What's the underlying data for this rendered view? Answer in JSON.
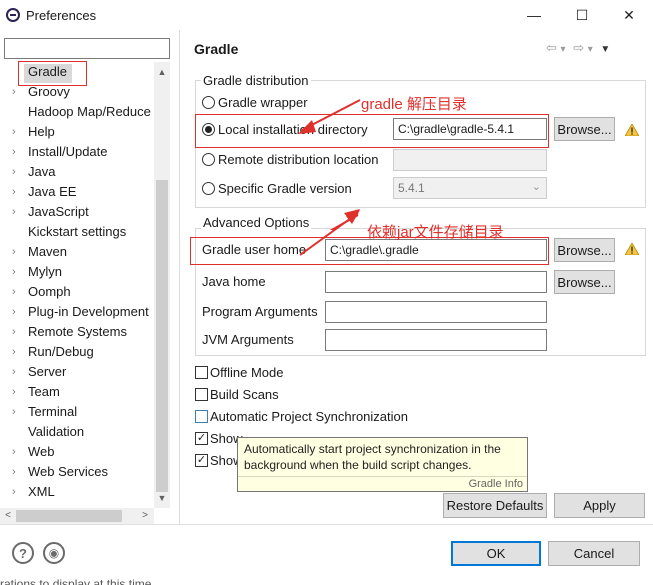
{
  "window": {
    "title": "Preferences",
    "minimize_glyph": "—",
    "maximize_glyph": "☐",
    "close_glyph": "✕"
  },
  "sidebar": {
    "filter_value": "",
    "items": [
      {
        "label": "Gradle",
        "expandable": false,
        "selected": true
      },
      {
        "label": "Groovy",
        "expandable": true
      },
      {
        "label": "Hadoop Map/Reduce",
        "expandable": false
      },
      {
        "label": "Help",
        "expandable": true
      },
      {
        "label": "Install/Update",
        "expandable": true
      },
      {
        "label": "Java",
        "expandable": true
      },
      {
        "label": "Java EE",
        "expandable": true
      },
      {
        "label": "JavaScript",
        "expandable": true
      },
      {
        "label": "Kickstart settings",
        "expandable": false
      },
      {
        "label": "Maven",
        "expandable": true
      },
      {
        "label": "Mylyn",
        "expandable": true
      },
      {
        "label": "Oomph",
        "expandable": true
      },
      {
        "label": "Plug-in Development",
        "expandable": true
      },
      {
        "label": "Remote Systems",
        "expandable": true
      },
      {
        "label": "Run/Debug",
        "expandable": true
      },
      {
        "label": "Server",
        "expandable": true
      },
      {
        "label": "Team",
        "expandable": true
      },
      {
        "label": "Terminal",
        "expandable": true
      },
      {
        "label": "Validation",
        "expandable": false
      },
      {
        "label": "Web",
        "expandable": true
      },
      {
        "label": "Web Services",
        "expandable": true
      },
      {
        "label": "XML",
        "expandable": true
      }
    ]
  },
  "page": {
    "title": "Gradle",
    "nav": {
      "back": "⇦",
      "back_menu": "▾",
      "forward": "⇨",
      "forward_menu": "▾",
      "menu": "▼"
    }
  },
  "distribution": {
    "group_title": "Gradle distribution",
    "wrapper_label": "Gradle wrapper",
    "local_label": "Local installation directory",
    "local_value": "C:\\gradle\\gradle-5.4.1",
    "remote_label": "Remote distribution location",
    "remote_value": "",
    "version_label": "Specific Gradle version",
    "version_value": "5.4.1",
    "browse_label": "Browse...",
    "selected": "local"
  },
  "advanced": {
    "group_title": "Advanced Options",
    "user_home_label": "Gradle user home",
    "user_home_value": "C:\\gradle\\.gradle",
    "java_home_label": "Java home",
    "java_home_value": "",
    "program_args_label": "Program Arguments",
    "program_args_value": "",
    "jvm_args_label": "JVM Arguments",
    "jvm_args_value": "",
    "browse_label": "Browse..."
  },
  "options": {
    "offline_mode": {
      "label": "Offline Mode",
      "checked": false
    },
    "build_scans": {
      "label": "Build Scans",
      "checked": false
    },
    "auto_sync": {
      "label": "Automatic Project Synchronization",
      "checked": false
    },
    "show_console": {
      "label": "Show",
      "checked": true
    },
    "show_executions": {
      "label": "Show",
      "checked": true
    },
    "check_glyph": "✓"
  },
  "tooltip": {
    "text": "Automatically start project synchronization in the background when the build script changes.",
    "footer": "Gradle Info"
  },
  "annotations": {
    "unzip_dir": "gradle 解压目录",
    "jar_dir": "依赖jar文件存储目录",
    "color": "#e0302c"
  },
  "buttons": {
    "restore_defaults": "Restore Defaults",
    "apply": "Apply",
    "ok": "OK",
    "cancel": "Cancel",
    "help_glyph": "?",
    "import_glyph": "◉"
  },
  "footer_text": "rations to display at this time."
}
